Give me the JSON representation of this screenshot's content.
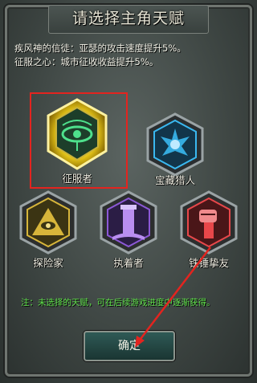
{
  "title": "请选择主角天赋",
  "description": [
    "疾风神的信徒：亚瑟的攻击速度提升5%。",
    "征服之心：城市征收收益提升5%。"
  ],
  "talents": [
    {
      "label": "征服者",
      "icon": "eye-icon",
      "color": "#f2d21b",
      "selected": true
    },
    {
      "label": "宝藏猎人",
      "icon": "treasure-icon",
      "color": "#3ab8f0",
      "selected": false
    },
    {
      "label": "探险家",
      "icon": "pyramid-eye-icon",
      "color": "#d7b53a",
      "selected": false
    },
    {
      "label": "执着者",
      "icon": "tower-icon",
      "color": "#8c58d6",
      "selected": false
    },
    {
      "label": "铁锤挚友",
      "icon": "fist-icon",
      "color": "#e8474a",
      "selected": false
    }
  ],
  "note": "注：未选择的天赋，可在后续游戏进度中逐渐获得。",
  "confirm_label": "确定"
}
